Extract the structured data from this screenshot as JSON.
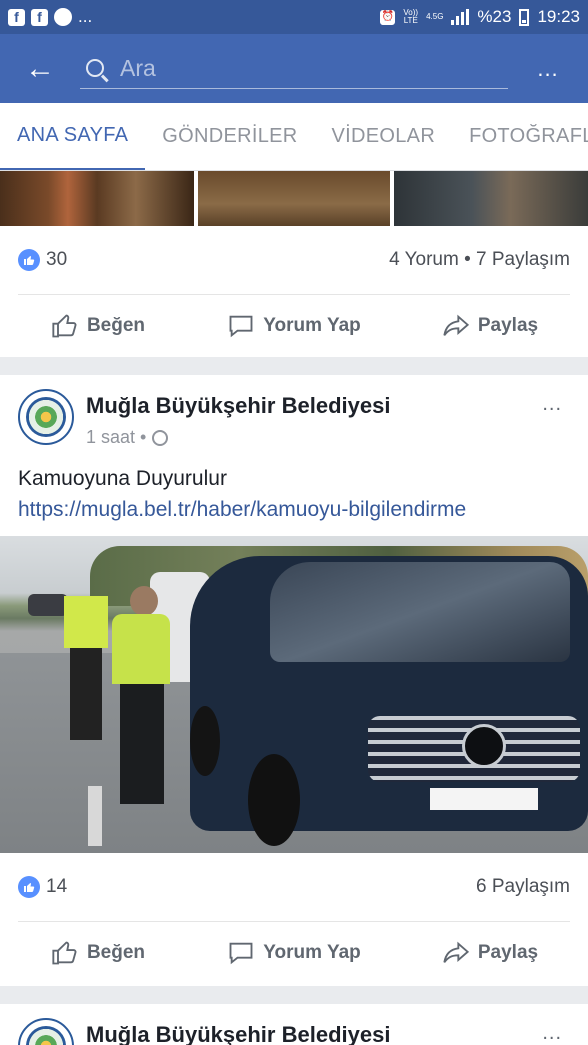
{
  "status_bar": {
    "left_icons": [
      "facebook-icon",
      "facebook-icon",
      "messenger-icon"
    ],
    "ellipsis": "...",
    "volte": "Vo))",
    "lte": "LTE",
    "network": "4.5G",
    "battery_pct": "%23",
    "time": "19:23"
  },
  "search": {
    "placeholder": "Ara",
    "more": "..."
  },
  "tabs": [
    {
      "label": "ANA SAYFA",
      "active": true
    },
    {
      "label": "GÖNDERİLER"
    },
    {
      "label": "VİDEOLAR"
    },
    {
      "label": "FOTOĞRAFLA"
    }
  ],
  "post1": {
    "likes": "30",
    "comments_shares": "4 Yorum • 7 Paylaşım"
  },
  "actions": {
    "like": "Beğen",
    "comment": "Yorum Yap",
    "share": "Paylaş"
  },
  "post2": {
    "page_name": "Muğla Büyükşehir Belediyesi",
    "time": "1 saat •",
    "more": "...",
    "text": "Kamuoyuna Duyurulur",
    "link": "https://mugla.bel.tr/haber/kamuoyu-bilgilendirme",
    "likes": "14",
    "shares": "6 Paylaşım"
  },
  "post3": {
    "page_name": "Muğla Büyükşehir Belediyesi",
    "more": "..."
  },
  "colors": {
    "header": "#4267b2",
    "statusbar": "#365899",
    "active_tab": "#4267b2",
    "link": "#365899"
  }
}
